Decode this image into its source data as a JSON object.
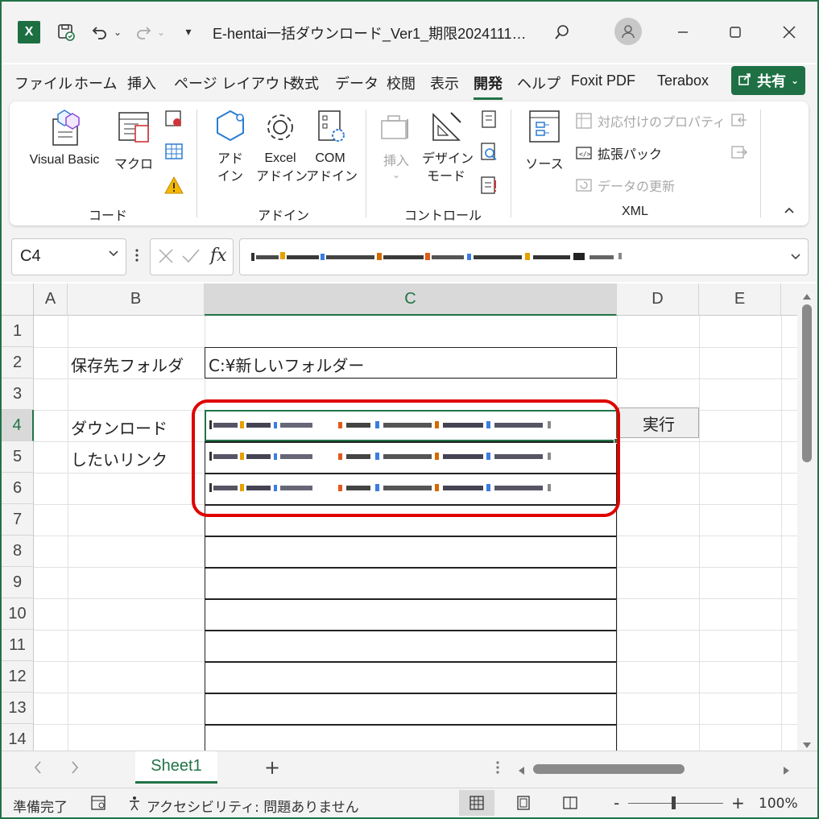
{
  "titlebar": {
    "app_icon": "X",
    "filename": "E-hentai一括ダウンロード_Ver1_期限2024111…",
    "icons": [
      "autosave-icon",
      "undo-icon",
      "redo-icon",
      "customize-qat-icon",
      "search-icon",
      "user-avatar-icon",
      "minimize-icon",
      "maximize-icon",
      "close-icon"
    ]
  },
  "menu": {
    "tabs": [
      "ファイル",
      "ホーム",
      "挿入",
      "ページ レイアウト",
      "数式",
      "データ",
      "校閲",
      "表示",
      "開発",
      "ヘルプ",
      "Foxit PDF",
      "Terabox"
    ],
    "active_tab": "開発",
    "share_label": "共有"
  },
  "ribbon": {
    "code": {
      "label": "コード",
      "visual_basic": "Visual Basic",
      "macro": "マクロ"
    },
    "addins": {
      "label": "アドイン",
      "addin": [
        "アド",
        "イン"
      ],
      "excel_addin": [
        "Excel",
        "アドイン"
      ],
      "com_addin": [
        "COM",
        "アドイン"
      ]
    },
    "controls": {
      "label": "コントロール",
      "insert": "挿入",
      "design_mode": [
        "デザイン",
        "モード"
      ]
    },
    "xml": {
      "label": "XML",
      "source": "ソース",
      "map_properties": "対応付けのプロパティ",
      "expansion_pack": "拡張パック",
      "refresh_data": "データの更新"
    }
  },
  "formula_bar": {
    "name_box": "C4",
    "fx": "fx"
  },
  "grid": {
    "columns": [
      "A",
      "B",
      "C",
      "D",
      "E"
    ],
    "selected_column": "C",
    "rows": [
      "1",
      "2",
      "3",
      "4",
      "5",
      "6",
      "7",
      "8",
      "9",
      "10",
      "11",
      "12",
      "13",
      "14"
    ],
    "selected_row": "4",
    "b2": "保存先フォルダ",
    "c2": "C:¥新しいフォルダー",
    "b4": "ダウンロード",
    "b5": "したいリンク",
    "exec_button": "実行"
  },
  "sheets": {
    "tabs": [
      "Sheet1"
    ],
    "add": "+"
  },
  "status": {
    "ready": "準備完了",
    "accessibility": "アクセシビリティ: 問題ありません",
    "zoom": "100%",
    "zoom_minus": "-",
    "zoom_plus": "+"
  },
  "colors": {
    "excel_green": "#217346",
    "highlight_red": "#e00000"
  }
}
